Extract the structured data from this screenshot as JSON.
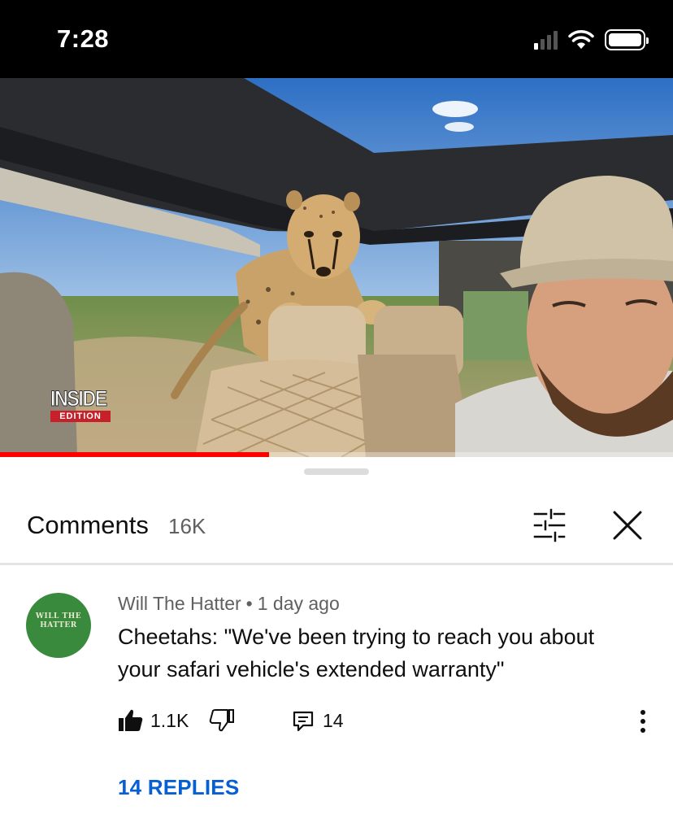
{
  "status_bar": {
    "time": "7:28"
  },
  "video": {
    "watermark_top": "INSIDE",
    "watermark_bottom": "EDITION",
    "progress_fraction": 0.4
  },
  "comments_panel": {
    "title": "Comments",
    "count": "16K"
  },
  "comment": {
    "author": "Will The Hatter",
    "separator": "•",
    "time_ago": "1 day ago",
    "text": "Cheetahs: \"We've been trying to reach you about your safari vehicle's extended warranty\"",
    "avatar_text_line1": "WILL THE",
    "avatar_text_line2": "HATTER",
    "likes": "1.1K",
    "reply_count": "14",
    "replies_link": "14 REPLIES"
  },
  "colors": {
    "accent_link": "#065fd4",
    "progress": "#ff0000",
    "avatar_bg": "#3a8a3d"
  },
  "icons": [
    "signal-icon",
    "wifi-icon",
    "battery-icon",
    "filter-icon",
    "close-icon",
    "like-icon",
    "dislike-icon",
    "reply-icon",
    "more-options-icon"
  ]
}
